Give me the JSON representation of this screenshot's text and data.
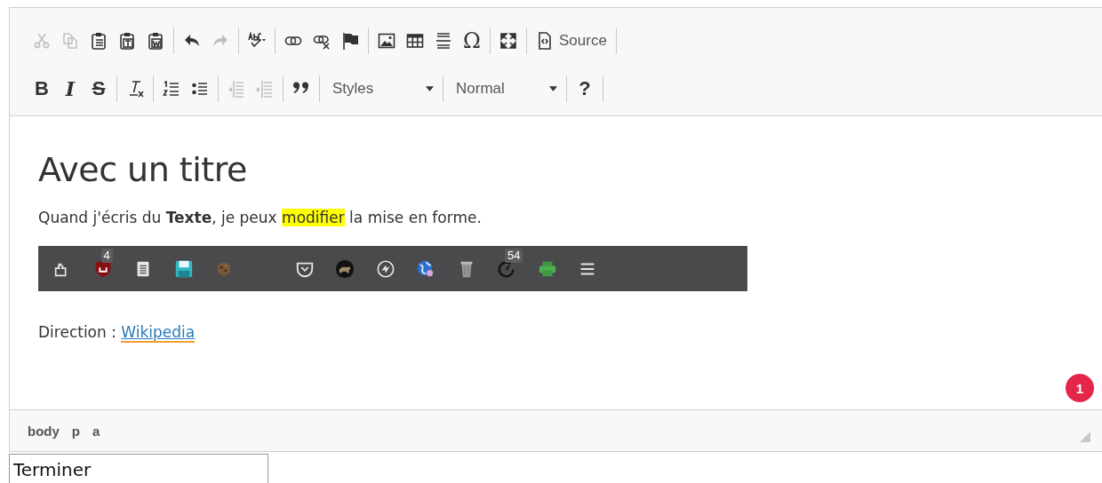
{
  "toolbar": {
    "rows": [
      {
        "groups": [
          [
            {
              "kind": "cut",
              "disabled": true
            },
            {
              "kind": "copy",
              "disabled": true
            },
            {
              "kind": "paste",
              "disabled": false
            },
            {
              "kind": "paste-text",
              "disabled": false
            },
            {
              "kind": "paste-word",
              "disabled": false
            }
          ],
          [
            {
              "kind": "undo",
              "disabled": false
            },
            {
              "kind": "redo",
              "disabled": true
            }
          ],
          [
            {
              "kind": "spellcheck",
              "disabled": false
            }
          ],
          [
            {
              "kind": "link",
              "disabled": false
            },
            {
              "kind": "unlink",
              "disabled": false
            },
            {
              "kind": "anchor",
              "disabled": false
            }
          ],
          [
            {
              "kind": "image",
              "disabled": false
            },
            {
              "kind": "table",
              "disabled": false
            },
            {
              "kind": "hrule",
              "disabled": false
            },
            {
              "kind": "omega",
              "glyph": "Ω",
              "disabled": false
            }
          ],
          [
            {
              "kind": "maximize",
              "disabled": false
            }
          ],
          [
            {
              "kind": "source",
              "label": "Source",
              "disabled": false
            }
          ]
        ]
      },
      {
        "groups": [
          [
            {
              "kind": "bold",
              "glyph": "B",
              "disabled": false
            },
            {
              "kind": "italic",
              "glyph": "I",
              "disabled": false
            },
            {
              "kind": "strike",
              "glyph": "S",
              "disabled": false
            }
          ],
          [
            {
              "kind": "remove-format",
              "disabled": false
            }
          ],
          [
            {
              "kind": "numbered-list",
              "disabled": false
            },
            {
              "kind": "bulleted-list",
              "disabled": false
            }
          ],
          [
            {
              "kind": "outdent",
              "disabled": true
            },
            {
              "kind": "indent",
              "disabled": true
            }
          ],
          [
            {
              "kind": "blockquote",
              "disabled": false
            }
          ],
          [
            {
              "kind": "combo",
              "label": "Styles",
              "disabled": false
            }
          ],
          [
            {
              "kind": "combo",
              "label": "Normal",
              "disabled": false
            }
          ],
          [
            {
              "kind": "help",
              "glyph": "?",
              "disabled": false
            }
          ]
        ]
      }
    ]
  },
  "content": {
    "heading": "Avec un titre",
    "paragraph": [
      {
        "text": "Quand j'écris du ",
        "kind": "plain"
      },
      {
        "text": "Texte",
        "kind": "bold"
      },
      {
        "text": ", je peux ",
        "kind": "plain"
      },
      {
        "text": "modifier",
        "kind": "highlight"
      },
      {
        "text": " la mise en forme.",
        "kind": "plain"
      }
    ],
    "screenshot": {
      "icons": [
        {
          "kind": "puzzle"
        },
        {
          "kind": "shield",
          "badge": "4"
        },
        {
          "kind": "notes"
        },
        {
          "kind": "floppy"
        },
        {
          "kind": "cookie"
        },
        {
          "kind": "gap"
        },
        {
          "kind": "pocket"
        },
        {
          "kind": "bear"
        },
        {
          "kind": "sync"
        },
        {
          "kind": "globe"
        },
        {
          "kind": "trash"
        },
        {
          "kind": "timer",
          "badge": "54"
        },
        {
          "kind": "printer"
        },
        {
          "kind": "menu"
        }
      ]
    },
    "direction": {
      "label": "Direction : ",
      "link": "Wikipedia"
    },
    "notification": "1"
  },
  "status_bar": {
    "path": [
      "body",
      "p",
      "a"
    ]
  },
  "field": {
    "value": "Terminer"
  }
}
